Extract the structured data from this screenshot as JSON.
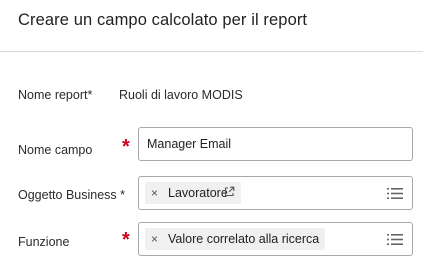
{
  "dialog": {
    "title": "Creare un campo calcolato per il report"
  },
  "fields": {
    "report_name": {
      "label": "Nome report*",
      "value": "Ruoli di lavoro MODIS"
    },
    "field_name": {
      "label": "Nome campo",
      "required_mark": "*",
      "value": "Manager Email"
    },
    "business_object": {
      "label": "Oggetto Business *",
      "chip_remove": "×",
      "chip_label": "Lavoratore"
    },
    "function": {
      "label": "Funzione",
      "required_mark": "*",
      "chip_remove": "×",
      "chip_label": "Valore correlato alla ricerca"
    }
  },
  "colors": {
    "required": "#d0021b",
    "border": "#a8a8a8",
    "chip_bg": "#f0f0f0"
  },
  "icons": [
    "external-link-icon",
    "list-icon",
    "close-icon"
  ]
}
